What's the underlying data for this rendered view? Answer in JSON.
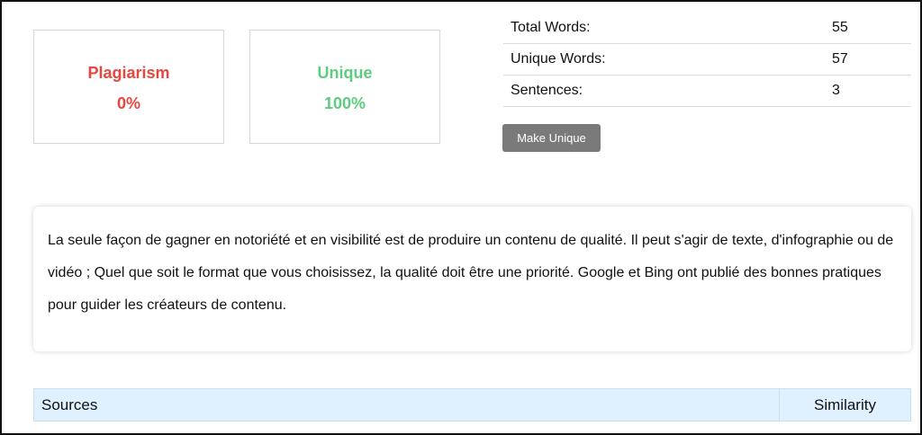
{
  "summary": {
    "plagiarism": {
      "label": "Plagiarism",
      "value": "0%",
      "color": "#e8473f"
    },
    "unique": {
      "label": "Unique",
      "value": "100%",
      "color": "#5ccc7e"
    }
  },
  "stats": [
    {
      "label": "Total Words:",
      "value": "55"
    },
    {
      "label": "Unique Words:",
      "value": "57"
    },
    {
      "label": "Sentences:",
      "value": "3"
    }
  ],
  "make_unique_button": "Make Unique",
  "content_text": "La seule façon de gagner en notoriété et en visibilité est de produire un contenu de qualité. Il peut s'agir de texte, d'infographie ou de vidéo ; Quel que soit le format que vous choisissez, la qualité doit être une priorité. Google et Bing ont publié des bonnes pratiques pour guider les créateurs de contenu.",
  "sources_table": {
    "columns": [
      "Sources",
      "Similarity"
    ]
  }
}
